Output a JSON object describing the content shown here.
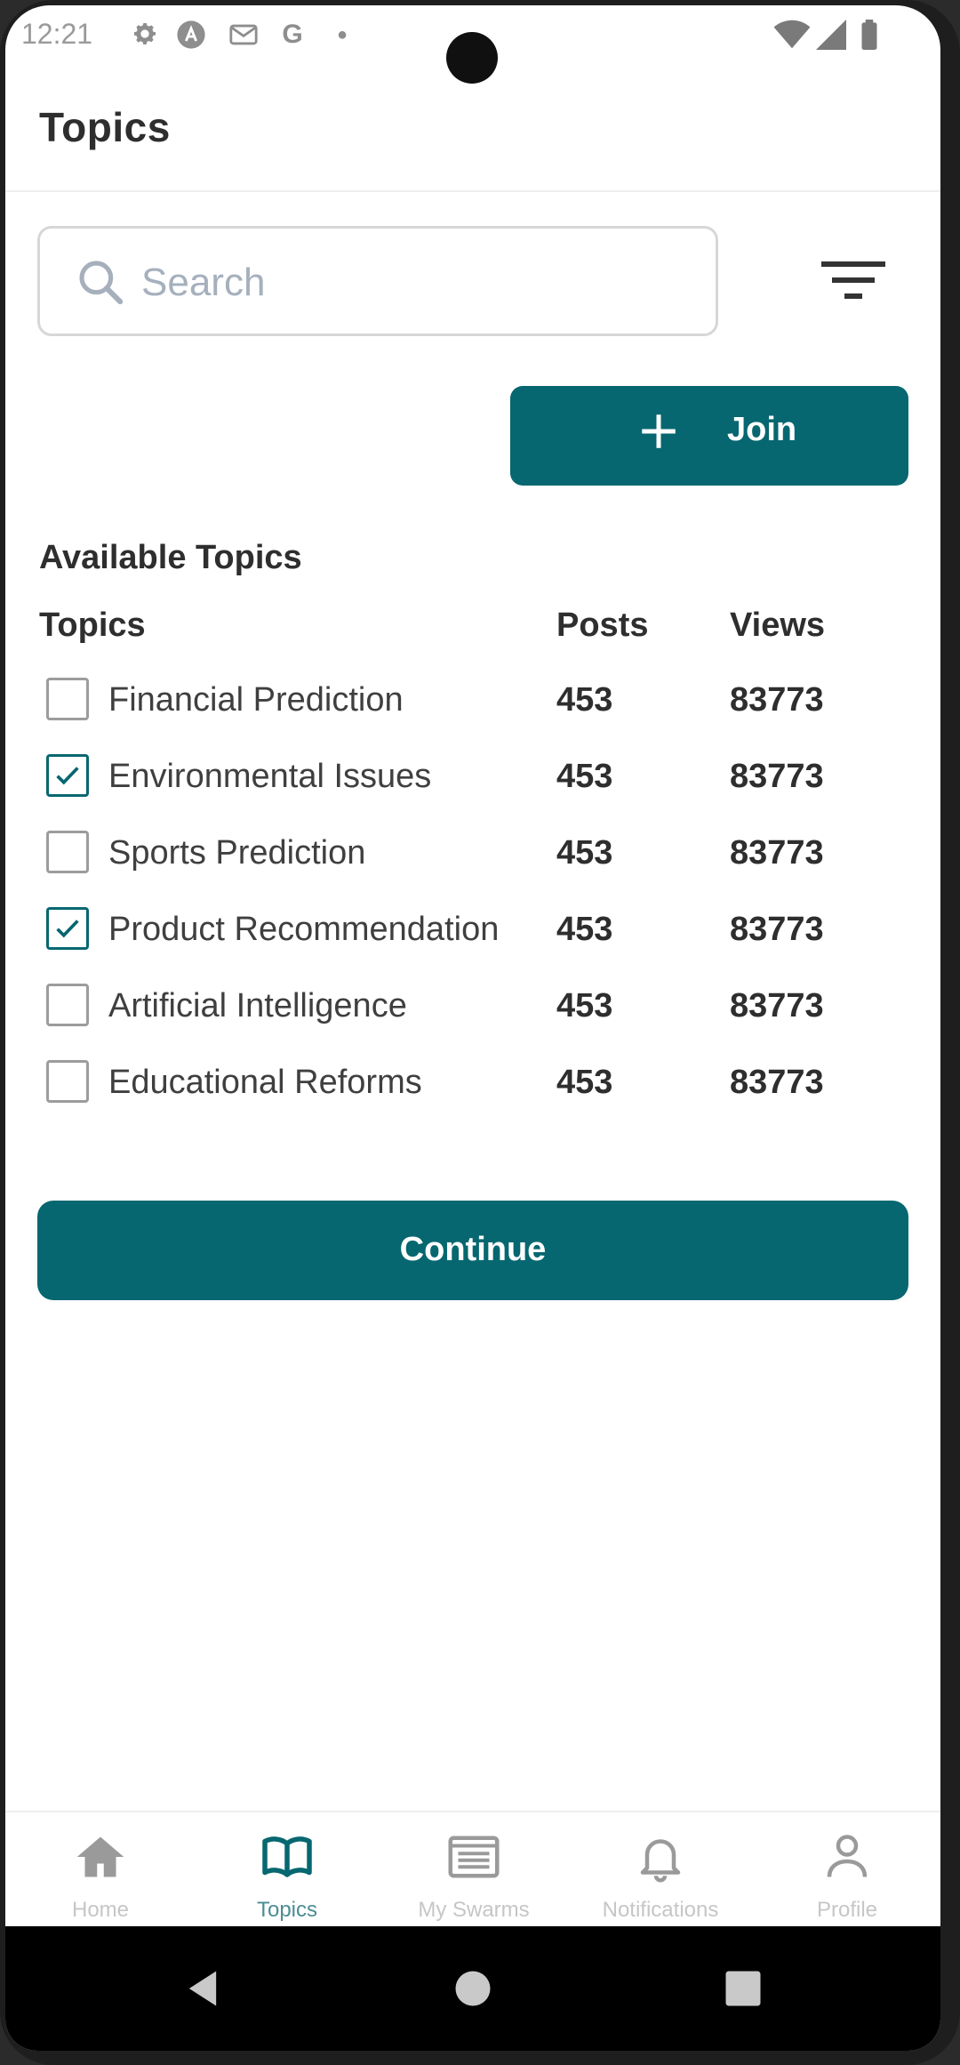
{
  "status_bar": {
    "time": "12:21",
    "icons": [
      "gear-icon",
      "a-circle-icon",
      "mail-icon",
      "google-g-icon",
      "dot-icon"
    ],
    "right_icons": [
      "wifi-icon",
      "signal-icon",
      "battery-icon"
    ]
  },
  "header": {
    "title": "Topics"
  },
  "search": {
    "placeholder": "Search",
    "value": ""
  },
  "join_button": {
    "label": "Join"
  },
  "section_title": "Available Topics",
  "table": {
    "columns": [
      "Topics",
      "Posts",
      "Views"
    ],
    "rows": [
      {
        "name": "Financial Prediction",
        "posts": "453",
        "views": "83773",
        "checked": false
      },
      {
        "name": "Environmental Issues",
        "posts": "453",
        "views": "83773",
        "checked": true
      },
      {
        "name": "Sports Prediction",
        "posts": "453",
        "views": "83773",
        "checked": false
      },
      {
        "name": "Product Recommendation",
        "posts": "453",
        "views": "83773",
        "checked": true
      },
      {
        "name": "Artificial Intelligence",
        "posts": "453",
        "views": "83773",
        "checked": false
      },
      {
        "name": "Educational Reforms",
        "posts": "453",
        "views": "83773",
        "checked": false
      }
    ]
  },
  "continue_button": {
    "label": "Continue"
  },
  "bottom_nav": {
    "items": [
      {
        "label": "Home",
        "icon": "home-icon",
        "active": false
      },
      {
        "label": "Topics",
        "icon": "book-icon",
        "active": true
      },
      {
        "label": "My Swarms",
        "icon": "list-icon",
        "active": false
      },
      {
        "label": "Notifications",
        "icon": "bell-icon",
        "active": false
      },
      {
        "label": "Profile",
        "icon": "person-icon",
        "active": false
      }
    ]
  },
  "colors": {
    "accent": "#066770",
    "active_nav": "#4c8d93",
    "inactive_nav": "#c6c6c6"
  }
}
